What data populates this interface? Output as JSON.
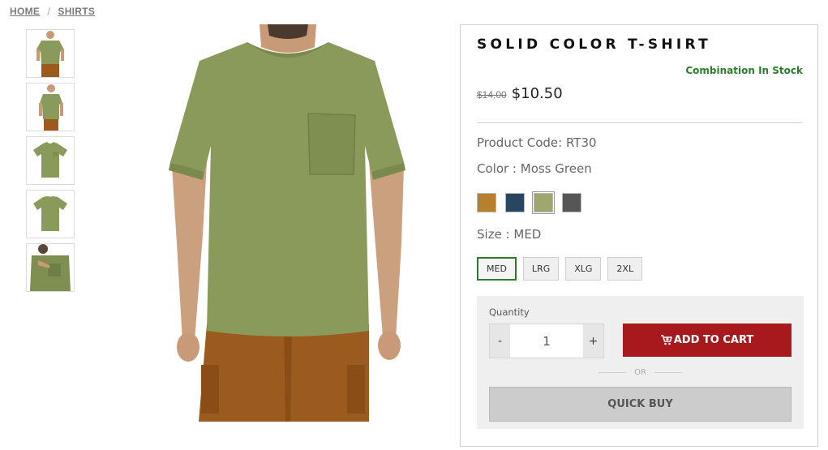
{
  "breadcrumb": {
    "home": "HOME",
    "separator": "/",
    "current": "SHIRTS"
  },
  "thumbnails": [
    "front-model",
    "side-model",
    "front-flat",
    "back-flat",
    "pocket-detail"
  ],
  "product": {
    "title": "SOLID COLOR T-SHIRT",
    "stock_status": "Combination In Stock",
    "old_price": "$14.00",
    "price": "$10.50",
    "product_code": "Product Code: RT30",
    "color_label": "Color : Moss Green",
    "size_label": "Size : MED"
  },
  "colors": [
    {
      "name": "Brown",
      "hex": "#b7802d",
      "selected": false
    },
    {
      "name": "Navy",
      "hex": "#284660",
      "selected": false
    },
    {
      "name": "Moss Green",
      "hex": "#9fa66f",
      "selected": true
    },
    {
      "name": "Charcoal",
      "hex": "#565656",
      "selected": false
    }
  ],
  "sizes": [
    {
      "label": "MED",
      "selected": true
    },
    {
      "label": "LRG",
      "selected": false
    },
    {
      "label": "XLG",
      "selected": false
    },
    {
      "label": "2XL",
      "selected": false
    }
  ],
  "purchase": {
    "quantity_label": "Quantity",
    "quantity_value": "1",
    "minus": "-",
    "plus": "+",
    "add_to_cart": "ADD TO CART",
    "or": "OR",
    "quick_buy": "QUICK BUY"
  },
  "colors_theme": {
    "accent_red": "#a8191e",
    "stock_green": "#2b7d2b",
    "shirt": "#8a9a5b",
    "pants": "#9b5a1e"
  }
}
